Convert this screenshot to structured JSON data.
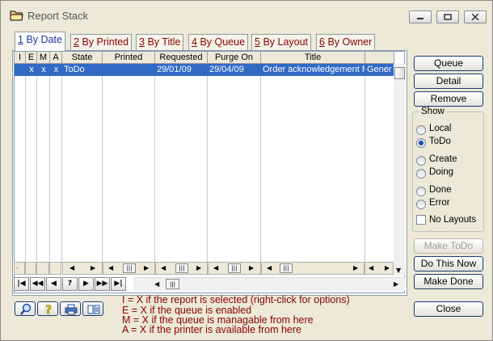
{
  "window": {
    "title": "Report Stack"
  },
  "tabs": [
    {
      "key": "1",
      "label": "By Date",
      "active": true
    },
    {
      "key": "2",
      "label": "By Printed"
    },
    {
      "key": "3",
      "label": "By Title"
    },
    {
      "key": "4",
      "label": "By Queue"
    },
    {
      "key": "5",
      "label": "By Layout"
    },
    {
      "key": "6",
      "label": "By Owner"
    }
  ],
  "grid": {
    "columns": [
      "I",
      "E",
      "M",
      "A",
      "State",
      "Printed",
      "Requested",
      "Purge On",
      "Title"
    ],
    "rows": [
      {
        "I": "",
        "E": "x",
        "M": "x",
        "A": "x",
        "State": "ToDo",
        "Printed": "",
        "Requested": "29/01/09",
        "Purge On": "29/04/09",
        "Title": "Order acknowledgement fo",
        "Extra": "Gener"
      }
    ],
    "footer_dot": "."
  },
  "buttons": {
    "queue": "Queue",
    "detail": "Detail",
    "remove": "Remove",
    "make_todo": "Make ToDo",
    "do_this_now": "Do This Now",
    "make_done": "Make Done",
    "close": "Close"
  },
  "show": {
    "title": "Show",
    "options": [
      "Local",
      "ToDo",
      "Create",
      "Doing",
      "Done",
      "Error"
    ],
    "selected": "ToDo",
    "no_layouts_label": "No Layouts"
  },
  "legend": [
    "I = X if the report is selected (right-click for options)",
    "E = X if the queue is enabled",
    "M = X if the queue is managable from here",
    "A = X if the printer is available from here"
  ],
  "colors": {
    "selection": "#316ac5",
    "legend_text": "#8b0000",
    "active_tab_text": "#1a3c9c"
  }
}
